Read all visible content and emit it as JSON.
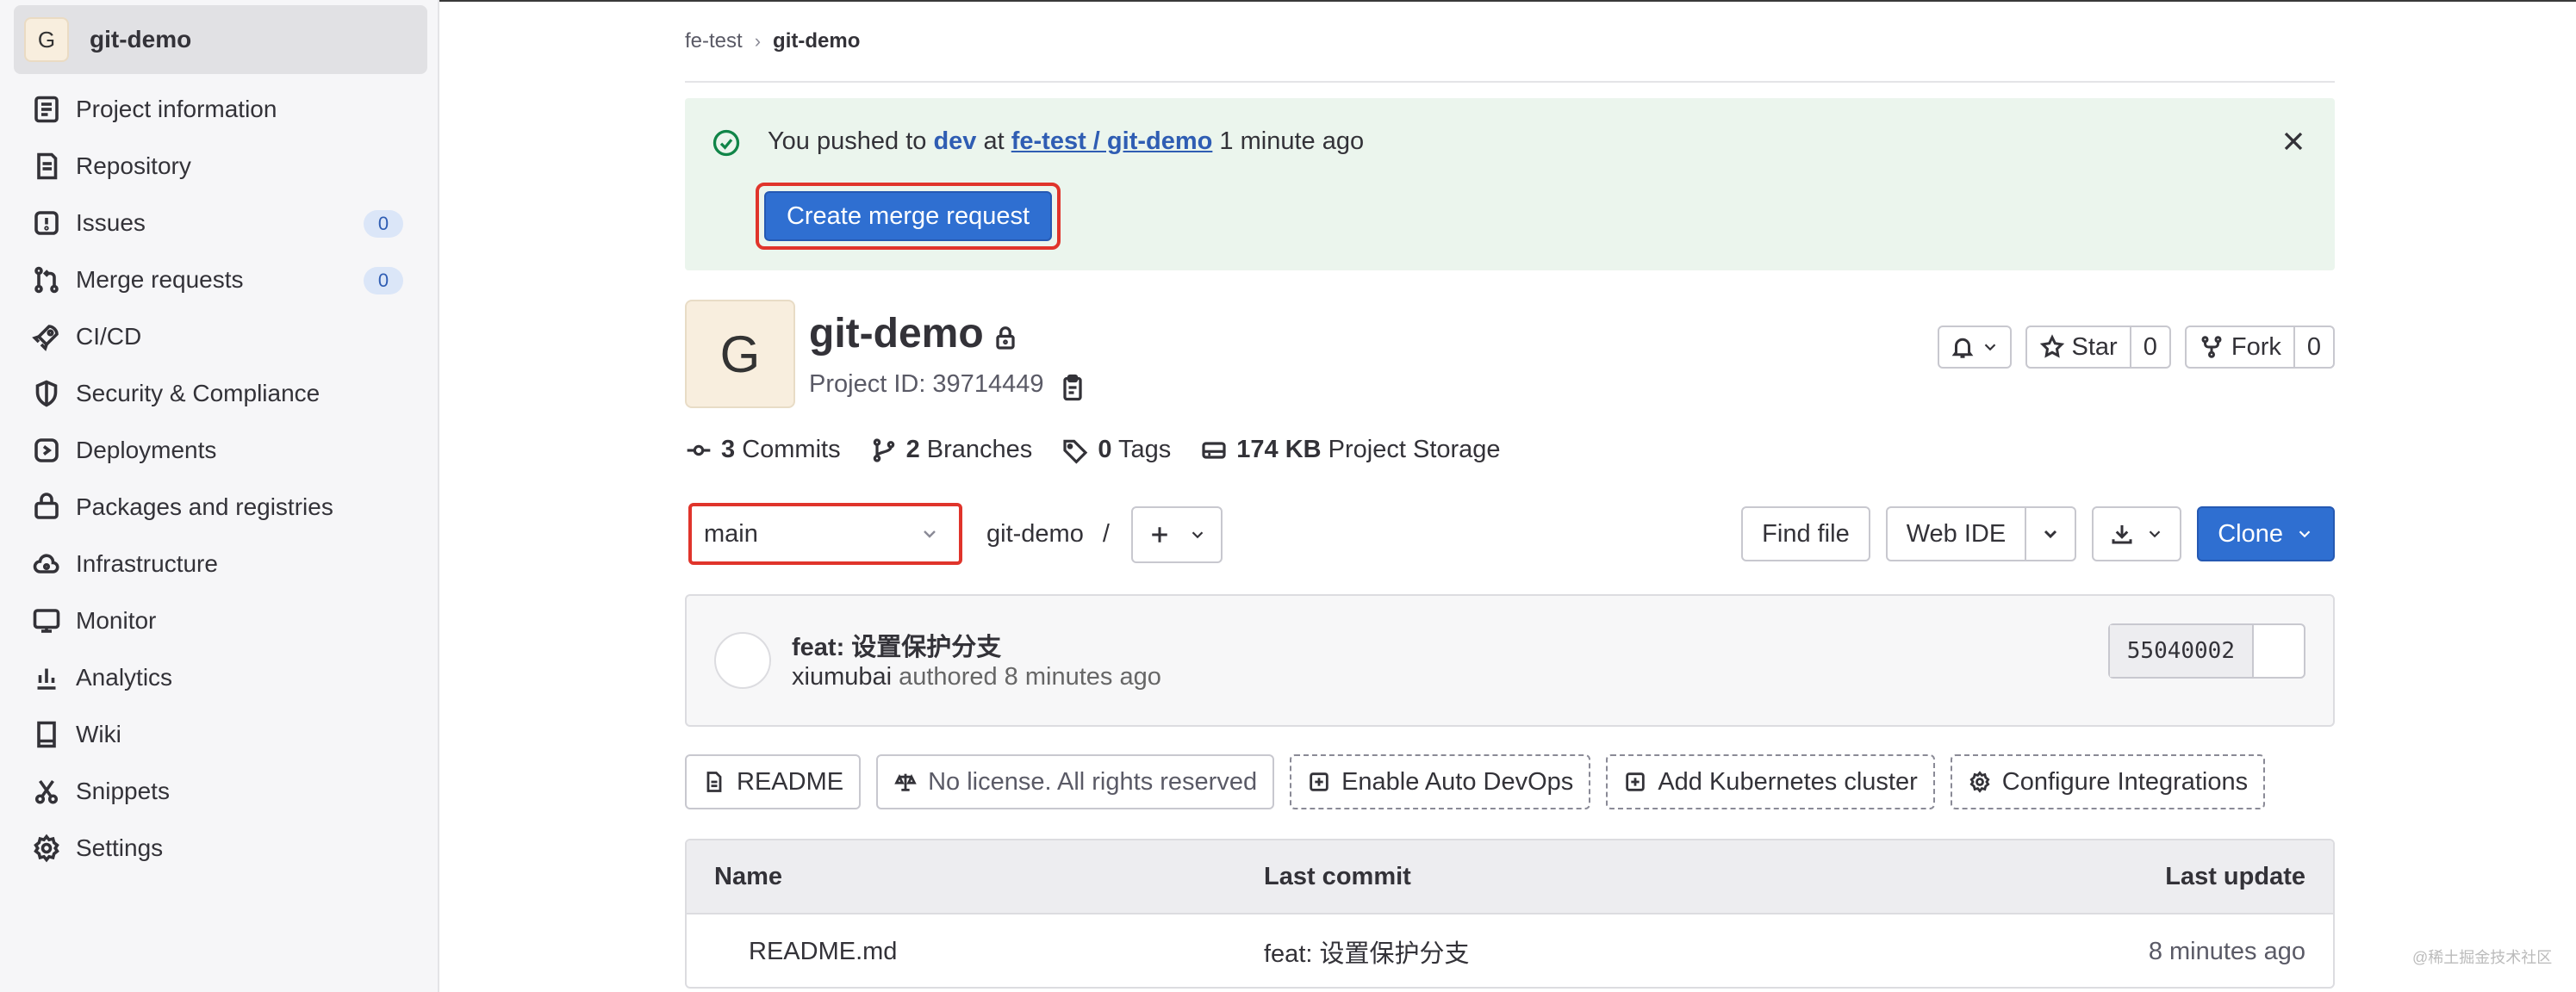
{
  "project": {
    "avatar_letter": "G",
    "name": "git-demo"
  },
  "sidebar": {
    "items": [
      {
        "label": "Project information",
        "icon": "project-info-icon"
      },
      {
        "label": "Repository",
        "icon": "repository-icon"
      },
      {
        "label": "Issues",
        "icon": "issues-icon",
        "count": "0"
      },
      {
        "label": "Merge requests",
        "icon": "merge-request-icon",
        "count": "0"
      },
      {
        "label": "CI/CD",
        "icon": "rocket-icon"
      },
      {
        "label": "Security & Compliance",
        "icon": "shield-icon"
      },
      {
        "label": "Deployments",
        "icon": "deployments-icon"
      },
      {
        "label": "Packages and registries",
        "icon": "package-icon"
      },
      {
        "label": "Infrastructure",
        "icon": "cloud-icon"
      },
      {
        "label": "Monitor",
        "icon": "monitor-icon"
      },
      {
        "label": "Analytics",
        "icon": "chart-icon"
      },
      {
        "label": "Wiki",
        "icon": "book-icon"
      },
      {
        "label": "Snippets",
        "icon": "scissors-icon"
      },
      {
        "label": "Settings",
        "icon": "gear-icon"
      }
    ]
  },
  "breadcrumb": {
    "parent": "fe-test",
    "separator": "›",
    "current": "git-demo"
  },
  "alert": {
    "prefix": "You pushed to ",
    "branch": "dev",
    "middle": " at ",
    "repo_link": "fe-test / git-demo",
    "suffix": " 1 minute ago",
    "button": "Create merge request"
  },
  "header": {
    "title": "git-demo",
    "project_id": "Project ID: 39714449",
    "star_label": "Star",
    "star_count": "0",
    "fork_label": "Fork",
    "fork_count": "0"
  },
  "stats": {
    "commits_count": "3",
    "commits_label": "Commits",
    "branches_count": "2",
    "branches_label": "Branches",
    "tags_count": "0",
    "tags_label": "Tags",
    "storage_value": "174 KB",
    "storage_label": "Project Storage"
  },
  "toolbar": {
    "branch": "main",
    "path": "git-demo",
    "path_sep": "/",
    "find_file": "Find file",
    "web_ide": "Web IDE",
    "clone": "Clone"
  },
  "last_commit": {
    "title": "feat: 设置保护分支",
    "author": "xiumubai",
    "authored": " authored 8 minutes ago",
    "sha": "55040002"
  },
  "chips": {
    "readme": "README",
    "license": "No license. All rights reserved",
    "auto_devops": "Enable Auto DevOps",
    "k8s": "Add Kubernetes cluster",
    "integrations": "Configure Integrations"
  },
  "files": {
    "columns": [
      "Name",
      "Last commit",
      "Last update"
    ],
    "rows": [
      {
        "name": "README.md",
        "commit": "feat: 设置保护分支",
        "updated": "8 minutes ago"
      }
    ]
  },
  "watermark": "@稀土掘金技术社区",
  "colors": {
    "accent": "#2f6fd1",
    "alert_bg": "#ebf5ed",
    "highlight_border": "#e0342b",
    "success": "#108548"
  }
}
